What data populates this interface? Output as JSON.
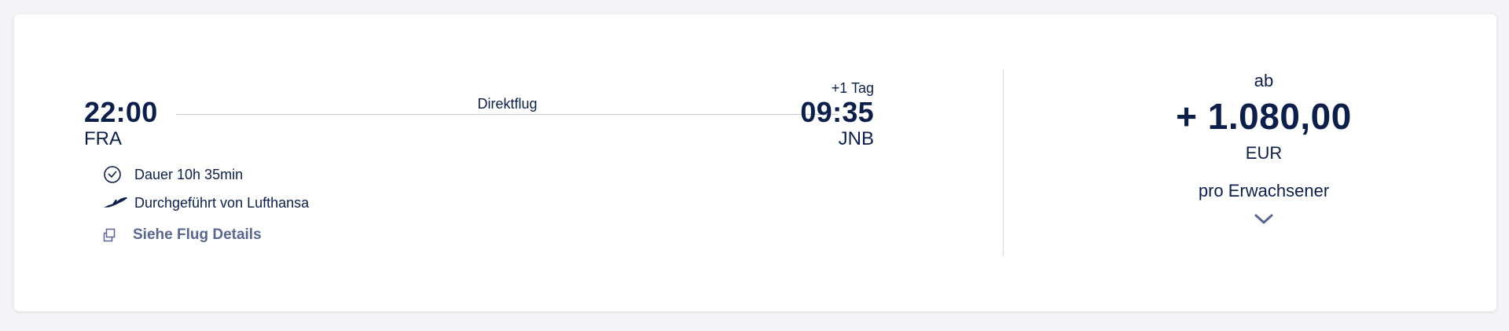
{
  "flight": {
    "departure": {
      "time": "22:00",
      "airport": "FRA"
    },
    "arrival": {
      "time": "09:35",
      "airport": "JNB",
      "day_offset": "+1 Tag"
    },
    "route_label": "Direktflug",
    "duration": "Dauer 10h 35min",
    "operated_by": "Durchgeführt von Lufthansa",
    "details_link": "Siehe Flug Details"
  },
  "fare": {
    "prefix": "ab",
    "amount": "+ 1.080,00",
    "currency": "EUR",
    "per": "pro Erwachsener"
  },
  "colors": {
    "primary_text": "#0c1f4b",
    "link": "#5b6690",
    "divider": "#d4d6dd",
    "background": "#f4f4f6",
    "card": "#ffffff"
  },
  "icons": {
    "duration": "clock-icon",
    "operator": "airplane-icon",
    "details": "external-window-icon",
    "expand": "chevron-down-icon"
  }
}
